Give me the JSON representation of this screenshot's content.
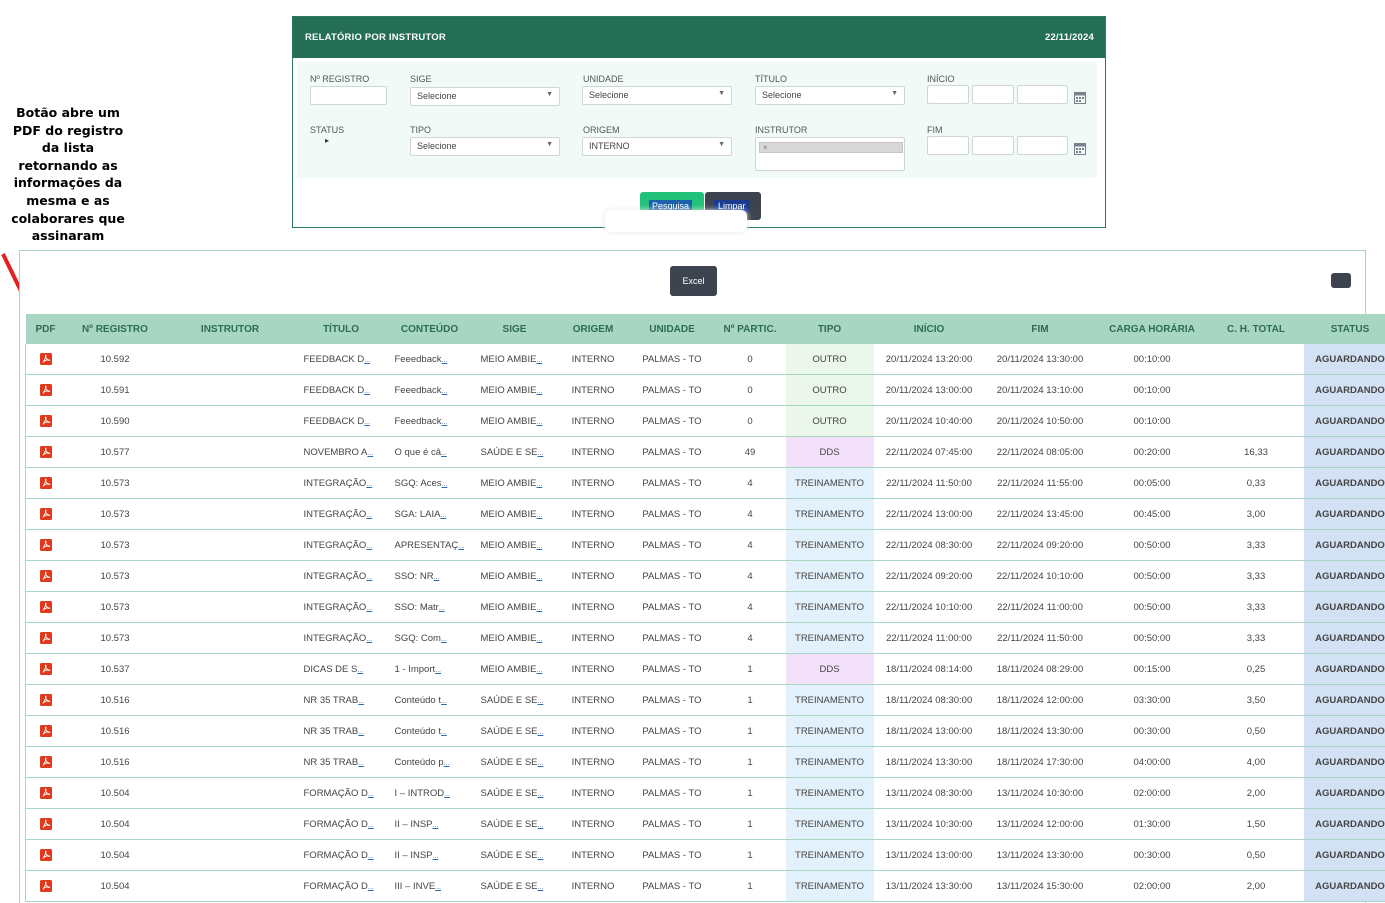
{
  "annotation": {
    "text": "Botão abre um PDF do registro da lista retornando as informações da mesma e as colaborares que assinaram",
    "arrow_color": "#e62020"
  },
  "filter_panel": {
    "title": "RELATÓRIO POR INSTRUTOR",
    "date": "22/11/2024",
    "header_color": "#236e55",
    "fields": {
      "registro": {
        "label": "Nº REGISTRO",
        "value": ""
      },
      "sige": {
        "label": "SIGE",
        "value": "Selecione"
      },
      "unidade": {
        "label": "UNIDADE",
        "value": "Selecione"
      },
      "titulo": {
        "label": "TÍTULO",
        "value": "Selecione"
      },
      "inicio": {
        "label": "INÍCIO"
      },
      "status": {
        "label": "STATUS",
        "value": "▸"
      },
      "tipo": {
        "label": "TIPO",
        "value": "Selecione"
      },
      "origem": {
        "label": "ORIGEM",
        "value": "INTERNO"
      },
      "instrutor": {
        "label": "INSTRUTOR",
        "tag_remove": "×"
      },
      "fim": {
        "label": "FIM"
      }
    },
    "buttons": {
      "search": "Pesquisa",
      "clear": "Limpar"
    }
  },
  "results": {
    "excel_label": "Excel",
    "columns": [
      "PDF",
      "Nº REGISTRO",
      "INSTRUTOR",
      "TÍTULO",
      "CONTEÚDO",
      "SIGE",
      "ORIGEM",
      "UNIDADE",
      "Nº PARTIC.",
      "TIPO",
      "INÍCIO",
      "FIM",
      "CARGA HORÁRIA",
      "C. H. TOTAL",
      "STATUS"
    ],
    "rows": [
      {
        "registro": "10.592",
        "titulo": "FEEDBACK D",
        "conteudo": "Feeedback",
        "sige": "MEIO AMBIE",
        "origem": "INTERNO",
        "unidade": "PALMAS - TO",
        "partic": "0",
        "tipo": "OUTRO",
        "inicio": "20/11/2024 13:20:00",
        "fim": "20/11/2024 13:30:00",
        "carga": "00:10:00",
        "total": "",
        "status": "AGUARDANDO"
      },
      {
        "registro": "10.591",
        "titulo": "FEEDBACK D",
        "conteudo": "Feeedback",
        "sige": "MEIO AMBIE",
        "origem": "INTERNO",
        "unidade": "PALMAS - TO",
        "partic": "0",
        "tipo": "OUTRO",
        "inicio": "20/11/2024 13:00:00",
        "fim": "20/11/2024 13:10:00",
        "carga": "00:10:00",
        "total": "",
        "status": "AGUARDANDO"
      },
      {
        "registro": "10.590",
        "titulo": "FEEDBACK D",
        "conteudo": "Feeedback",
        "sige": "MEIO AMBIE",
        "origem": "INTERNO",
        "unidade": "PALMAS - TO",
        "partic": "0",
        "tipo": "OUTRO",
        "inicio": "20/11/2024 10:40:00",
        "fim": "20/11/2024 10:50:00",
        "carga": "00:10:00",
        "total": "",
        "status": "AGUARDANDO"
      },
      {
        "registro": "10.577",
        "titulo": "NOVEMBRO A",
        "conteudo": "O que é câ",
        "sige": "SAÚDE E SE",
        "origem": "INTERNO",
        "unidade": "PALMAS - TO",
        "partic": "49",
        "tipo": "DDS",
        "inicio": "22/11/2024 07:45:00",
        "fim": "22/11/2024 08:05:00",
        "carga": "00:20:00",
        "total": "16,33",
        "status": "AGUARDANDO"
      },
      {
        "registro": "10.573",
        "titulo": "INTEGRAÇÃO",
        "conteudo": "SGQ: Aces",
        "sige": "MEIO AMBIE",
        "origem": "INTERNO",
        "unidade": "PALMAS - TO",
        "partic": "4",
        "tipo": "TREINAMENTO",
        "inicio": "22/11/2024 11:50:00",
        "fim": "22/11/2024 11:55:00",
        "carga": "00:05:00",
        "total": "0,33",
        "status": "AGUARDANDO"
      },
      {
        "registro": "10.573",
        "titulo": "INTEGRAÇÃO",
        "conteudo": "SGA: LAIA",
        "sige": "MEIO AMBIE",
        "origem": "INTERNO",
        "unidade": "PALMAS - TO",
        "partic": "4",
        "tipo": "TREINAMENTO",
        "inicio": "22/11/2024 13:00:00",
        "fim": "22/11/2024 13:45:00",
        "carga": "00:45:00",
        "total": "3,00",
        "status": "AGUARDANDO"
      },
      {
        "registro": "10.573",
        "titulo": "INTEGRAÇÃO",
        "conteudo": "APRESENTAÇ",
        "sige": "MEIO AMBIE",
        "origem": "INTERNO",
        "unidade": "PALMAS - TO",
        "partic": "4",
        "tipo": "TREINAMENTO",
        "inicio": "22/11/2024 08:30:00",
        "fim": "22/11/2024 09:20:00",
        "carga": "00:50:00",
        "total": "3,33",
        "status": "AGUARDANDO"
      },
      {
        "registro": "10.573",
        "titulo": "INTEGRAÇÃO",
        "conteudo": "SSO: NR",
        "sige": "MEIO AMBIE",
        "origem": "INTERNO",
        "unidade": "PALMAS - TO",
        "partic": "4",
        "tipo": "TREINAMENTO",
        "inicio": "22/11/2024 09:20:00",
        "fim": "22/11/2024 10:10:00",
        "carga": "00:50:00",
        "total": "3,33",
        "status": "AGUARDANDO"
      },
      {
        "registro": "10.573",
        "titulo": "INTEGRAÇÃO",
        "conteudo": "SSO: Matr",
        "sige": "MEIO AMBIE",
        "origem": "INTERNO",
        "unidade": "PALMAS - TO",
        "partic": "4",
        "tipo": "TREINAMENTO",
        "inicio": "22/11/2024 10:10:00",
        "fim": "22/11/2024 11:00:00",
        "carga": "00:50:00",
        "total": "3,33",
        "status": "AGUARDANDO"
      },
      {
        "registro": "10.573",
        "titulo": "INTEGRAÇÃO",
        "conteudo": "SGQ: Com",
        "sige": "MEIO AMBIE",
        "origem": "INTERNO",
        "unidade": "PALMAS - TO",
        "partic": "4",
        "tipo": "TREINAMENTO",
        "inicio": "22/11/2024 11:00:00",
        "fim": "22/11/2024 11:50:00",
        "carga": "00:50:00",
        "total": "3,33",
        "status": "AGUARDANDO"
      },
      {
        "registro": "10.537",
        "titulo": "DICAS DE S",
        "conteudo": "1 - Import",
        "sige": "MEIO AMBIE",
        "origem": "INTERNO",
        "unidade": "PALMAS - TO",
        "partic": "1",
        "tipo": "DDS",
        "inicio": "18/11/2024 08:14:00",
        "fim": "18/11/2024 08:29:00",
        "carga": "00:15:00",
        "total": "0,25",
        "status": "AGUARDANDO"
      },
      {
        "registro": "10.516",
        "titulo": "NR 35 TRAB",
        "conteudo": "Conteúdo t",
        "sige": "SAÚDE E SE",
        "origem": "INTERNO",
        "unidade": "PALMAS - TO",
        "partic": "1",
        "tipo": "TREINAMENTO",
        "inicio": "18/11/2024 08:30:00",
        "fim": "18/11/2024 12:00:00",
        "carga": "03:30:00",
        "total": "3,50",
        "status": "AGUARDANDO"
      },
      {
        "registro": "10.516",
        "titulo": "NR 35 TRAB",
        "conteudo": "Conteúdo t",
        "sige": "SAÚDE E SE",
        "origem": "INTERNO",
        "unidade": "PALMAS - TO",
        "partic": "1",
        "tipo": "TREINAMENTO",
        "inicio": "18/11/2024 13:00:00",
        "fim": "18/11/2024 13:30:00",
        "carga": "00:30:00",
        "total": "0,50",
        "status": "AGUARDANDO"
      },
      {
        "registro": "10.516",
        "titulo": "NR 35 TRAB",
        "conteudo": "Conteúdo p",
        "sige": "SAÚDE E SE",
        "origem": "INTERNO",
        "unidade": "PALMAS - TO",
        "partic": "1",
        "tipo": "TREINAMENTO",
        "inicio": "18/11/2024 13:30:00",
        "fim": "18/11/2024 17:30:00",
        "carga": "04:00:00",
        "total": "4,00",
        "status": "AGUARDANDO"
      },
      {
        "registro": "10.504",
        "titulo": "FORMAÇÃO D",
        "conteudo": "I – INTROD",
        "sige": "SAÚDE E SE",
        "origem": "INTERNO",
        "unidade": "PALMAS - TO",
        "partic": "1",
        "tipo": "TREINAMENTO",
        "inicio": "13/11/2024 08:30:00",
        "fim": "13/11/2024 10:30:00",
        "carga": "02:00:00",
        "total": "2,00",
        "status": "AGUARDANDO"
      },
      {
        "registro": "10.504",
        "titulo": "FORMAÇÃO D",
        "conteudo": "II – INSP",
        "sige": "SAÚDE E SE",
        "origem": "INTERNO",
        "unidade": "PALMAS - TO",
        "partic": "1",
        "tipo": "TREINAMENTO",
        "inicio": "13/11/2024 10:30:00",
        "fim": "13/11/2024 12:00:00",
        "carga": "01:30:00",
        "total": "1,50",
        "status": "AGUARDANDO"
      },
      {
        "registro": "10.504",
        "titulo": "FORMAÇÃO D",
        "conteudo": "II – INSP",
        "sige": "SAÚDE E SE",
        "origem": "INTERNO",
        "unidade": "PALMAS - TO",
        "partic": "1",
        "tipo": "TREINAMENTO",
        "inicio": "13/11/2024 13:00:00",
        "fim": "13/11/2024 13:30:00",
        "carga": "00:30:00",
        "total": "0,50",
        "status": "AGUARDANDO"
      },
      {
        "registro": "10.504",
        "titulo": "FORMAÇÃO D",
        "conteudo": "III – INVE",
        "sige": "SAÚDE E SE",
        "origem": "INTERNO",
        "unidade": "PALMAS - TO",
        "partic": "1",
        "tipo": "TREINAMENTO",
        "inicio": "13/11/2024 13:30:00",
        "fim": "13/11/2024 15:30:00",
        "carga": "02:00:00",
        "total": "2,00",
        "status": "AGUARDANDO"
      }
    ]
  },
  "colors": {
    "header_green": "#236e55",
    "table_header": "#a7d7c2",
    "status_bg": "#d3e1f4",
    "status_text": "#3a7ac8",
    "pdf_red": "#e03a1e"
  }
}
